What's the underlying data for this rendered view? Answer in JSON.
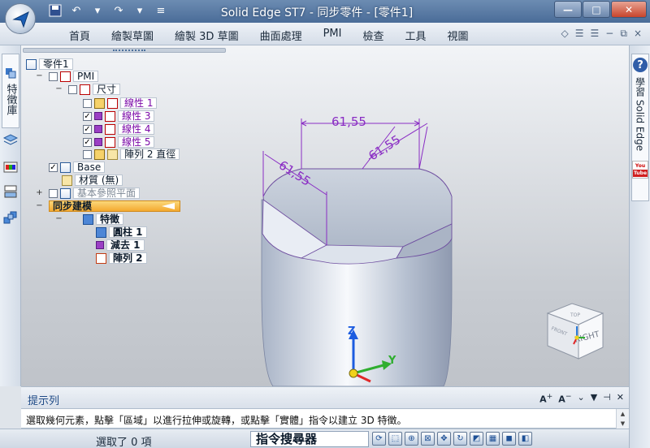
{
  "window": {
    "title": "Solid Edge ST7 - 同步零件 - [零件1]",
    "minimize": "—",
    "maximize": "□",
    "close": "✕"
  },
  "menu": {
    "items": [
      "首頁",
      "繪製草圖",
      "繪製 3D 草圖",
      "曲面處理",
      "PMI",
      "檢查",
      "工具",
      "視圖"
    ]
  },
  "left_panel": {
    "tab_label": "特徵庫"
  },
  "right_panel": {
    "tab_label": "學習 Solid Edge",
    "help_glyph": "?",
    "youtube_top": "You",
    "youtube_bottom": "Tube"
  },
  "tree": {
    "root": "零件1",
    "pmi": "PMI",
    "dimensions": "尺寸",
    "linear1": "線性 1",
    "linear3": "線性 3",
    "linear4": "線性 4",
    "linear5": "線性 5",
    "pattern_diameter": "陣列 2 直徑",
    "base": "Base",
    "material": "材質 (無)",
    "ref_planes": "基本參照平面",
    "sync_modeling": "同步建模",
    "features": "特徵",
    "cylinder": "圓柱 1",
    "cutout": "減去 1",
    "pattern": "陣列 2"
  },
  "model": {
    "dim_top": "61,55",
    "dim_left": "61,55",
    "dim_right": "61,55",
    "axis_x": "X",
    "axis_y": "Y",
    "axis_z": "Z"
  },
  "viewcube": {
    "top": "TOP",
    "front": "FRONT",
    "right": "RIGHT"
  },
  "hint": {
    "title": "提示列",
    "tool_font_up": "A",
    "tool_font_down": "A",
    "prompt": "選取幾何元素，點擊「區域」以進行拉伸或旋轉，或點擊「實體」指令以建立 3D 特徵。"
  },
  "status": {
    "selection": "選取了 0 項",
    "command_finder": "指令搜尋器"
  },
  "colors": {
    "title_bar": "#4a6c98",
    "selected_node": "#f4a92f",
    "dimension": "#8a2dc4"
  }
}
